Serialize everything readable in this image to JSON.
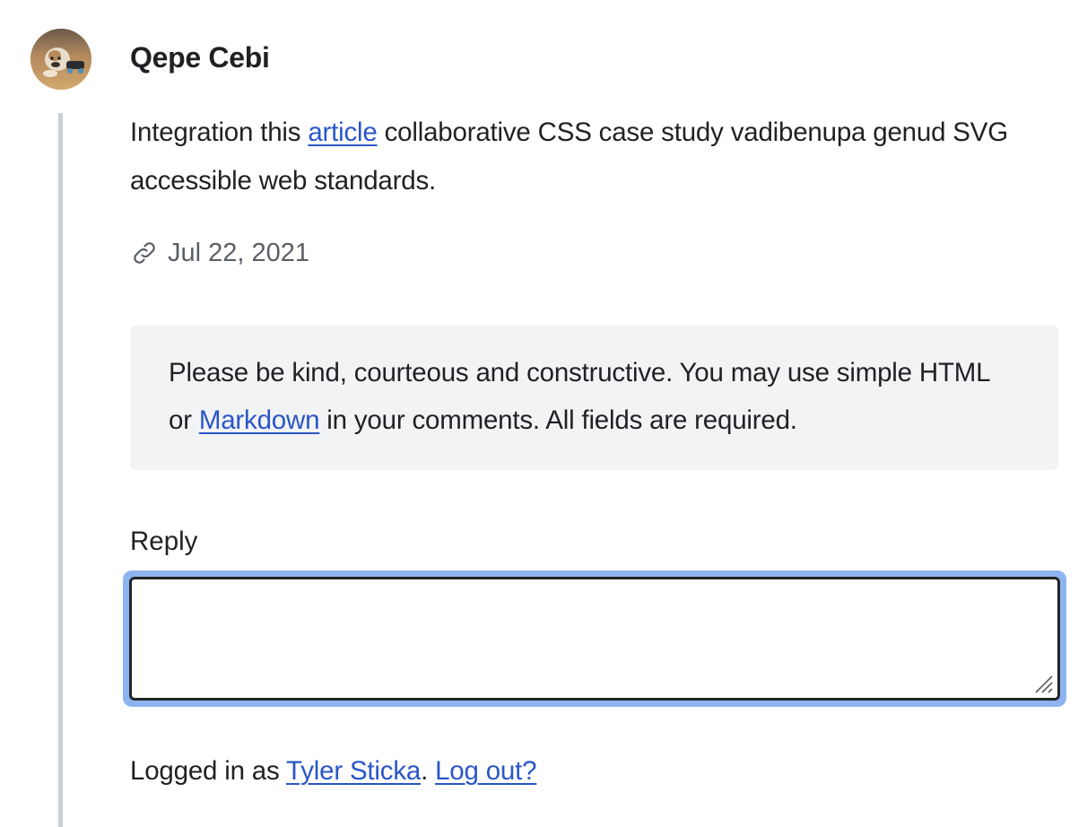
{
  "comment": {
    "author": "Qepe Cebi",
    "body": {
      "before_link": "Integration this ",
      "link_text": "article",
      "after_link": " collaborative CSS case study vadibenupa genud SVG accessible web standards."
    },
    "date": "Jul 22, 2021",
    "permalink_icon": "link-icon",
    "avatar_icon": "avatar-photo"
  },
  "notice": {
    "before_link": "Please be kind, courteous and constructive. You may use simple HTML or ",
    "link_text": "Markdown",
    "after_link": " in your comments. All fields are required."
  },
  "reply": {
    "label": "Reply",
    "value": "",
    "placeholder": ""
  },
  "session": {
    "prefix": "Logged in as ",
    "user_name": "Tyler Sticka",
    "separator": ". ",
    "logout_text": "Log out?"
  },
  "colors": {
    "link": "#2a56c6",
    "focus_ring": "#8db4f0",
    "notice_background": "#f2f3f5",
    "thread_line": "#c8d0d8",
    "meta_text": "#5a5f66"
  }
}
